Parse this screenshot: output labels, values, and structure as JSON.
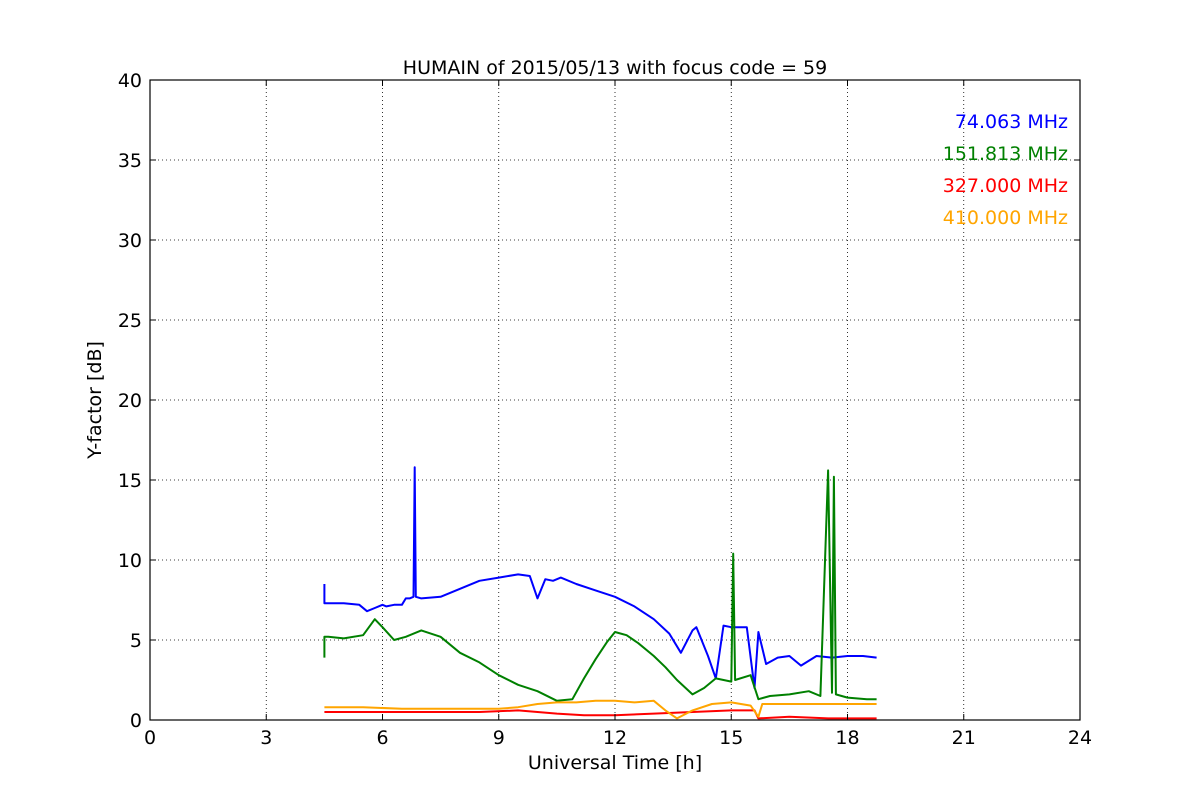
{
  "chart_data": {
    "type": "line",
    "title": "HUMAIN of 2015/05/13 with focus code = 59",
    "xlabel": "Universal Time [h]",
    "ylabel": "Y-factor [dB]",
    "xlim": [
      0,
      24
    ],
    "ylim": [
      0,
      40
    ],
    "xticks": [
      "0",
      "3",
      "6",
      "9",
      "12",
      "15",
      "18",
      "21",
      "24"
    ],
    "yticks": [
      "0",
      "5",
      "10",
      "15",
      "20",
      "25",
      "30",
      "35",
      "40"
    ],
    "grid": true,
    "legend_position": "top-right",
    "series": [
      {
        "name": "74.063 MHz",
        "color": "#0000ff",
        "x": [
          4.5,
          4.5,
          4.6,
          5.0,
          5.4,
          5.6,
          5.8,
          6.0,
          6.1,
          6.3,
          6.5,
          6.6,
          6.7,
          6.8,
          6.83,
          6.86,
          7.0,
          7.5,
          8.0,
          8.5,
          9.0,
          9.5,
          9.8,
          10.0,
          10.2,
          10.4,
          10.6,
          11.0,
          11.5,
          12.0,
          12.5,
          13.0,
          13.4,
          13.7,
          14.0,
          14.1,
          14.4,
          14.6,
          14.8,
          15.0,
          15.4,
          15.6,
          15.7,
          15.9,
          16.2,
          16.5,
          16.8,
          17.2,
          17.6,
          18.0,
          18.4,
          18.75
        ],
        "y": [
          8.5,
          7.3,
          7.3,
          7.3,
          7.2,
          6.8,
          7.0,
          7.2,
          7.1,
          7.2,
          7.2,
          7.6,
          7.6,
          7.7,
          15.8,
          7.7,
          7.6,
          7.7,
          8.2,
          8.7,
          8.9,
          9.1,
          9.0,
          7.6,
          8.8,
          8.7,
          8.9,
          8.5,
          8.1,
          7.7,
          7.1,
          6.3,
          5.4,
          4.2,
          5.6,
          5.8,
          4.0,
          2.6,
          5.9,
          5.8,
          5.8,
          2.0,
          5.5,
          3.5,
          3.9,
          4.0,
          3.4,
          4.0,
          3.9,
          4.0,
          4.0,
          3.9
        ]
      },
      {
        "name": "151.813 MHz",
        "color": "#008000",
        "x": [
          4.5,
          4.5,
          4.6,
          5.0,
          5.5,
          5.8,
          6.0,
          6.3,
          6.6,
          7.0,
          7.5,
          8.0,
          8.5,
          9.0,
          9.5,
          10.0,
          10.5,
          10.9,
          11.2,
          11.5,
          11.8,
          12.0,
          12.3,
          12.6,
          13.0,
          13.3,
          13.6,
          14.0,
          14.3,
          14.6,
          15.0,
          15.05,
          15.1,
          15.5,
          15.7,
          16.0,
          16.5,
          17.0,
          17.3,
          17.5,
          17.6,
          17.65,
          17.7,
          18.0,
          18.5,
          18.75
        ],
        "y": [
          3.9,
          5.2,
          5.2,
          5.1,
          5.3,
          6.3,
          5.8,
          5.0,
          5.2,
          5.6,
          5.2,
          4.2,
          3.6,
          2.8,
          2.2,
          1.8,
          1.2,
          1.3,
          2.6,
          3.8,
          4.9,
          5.5,
          5.3,
          4.8,
          4.0,
          3.3,
          2.5,
          1.6,
          2.0,
          2.6,
          2.4,
          10.4,
          2.5,
          2.8,
          1.3,
          1.5,
          1.6,
          1.8,
          1.5,
          15.6,
          1.7,
          15.2,
          1.6,
          1.4,
          1.3,
          1.3
        ]
      },
      {
        "name": "327.000 MHz",
        "color": "#ff0000",
        "x": [
          4.5,
          5.5,
          6.5,
          7.5,
          8.5,
          9.5,
          10.5,
          11.2,
          12.0,
          13.0,
          14.0,
          15.0,
          15.6,
          15.7,
          16.5,
          17.5,
          18.75
        ],
        "y": [
          0.5,
          0.5,
          0.5,
          0.5,
          0.5,
          0.6,
          0.4,
          0.3,
          0.3,
          0.4,
          0.5,
          0.6,
          0.6,
          0.1,
          0.2,
          0.1,
          0.1
        ]
      },
      {
        "name": "410.000 MHz",
        "color": "#ffa500",
        "x": [
          4.5,
          5.5,
          6.5,
          7.5,
          8.5,
          9.0,
          9.5,
          10.0,
          10.5,
          11.0,
          11.5,
          12.0,
          12.5,
          13.0,
          13.3,
          13.6,
          14.0,
          14.5,
          15.0,
          15.5,
          15.7,
          15.8,
          16.5,
          17.5,
          18.75
        ],
        "y": [
          0.8,
          0.8,
          0.7,
          0.7,
          0.7,
          0.7,
          0.8,
          1.0,
          1.1,
          1.1,
          1.2,
          1.2,
          1.1,
          1.2,
          0.6,
          0.1,
          0.6,
          1.0,
          1.1,
          0.9,
          0.2,
          1.0,
          1.0,
          1.0,
          1.0
        ]
      }
    ]
  }
}
